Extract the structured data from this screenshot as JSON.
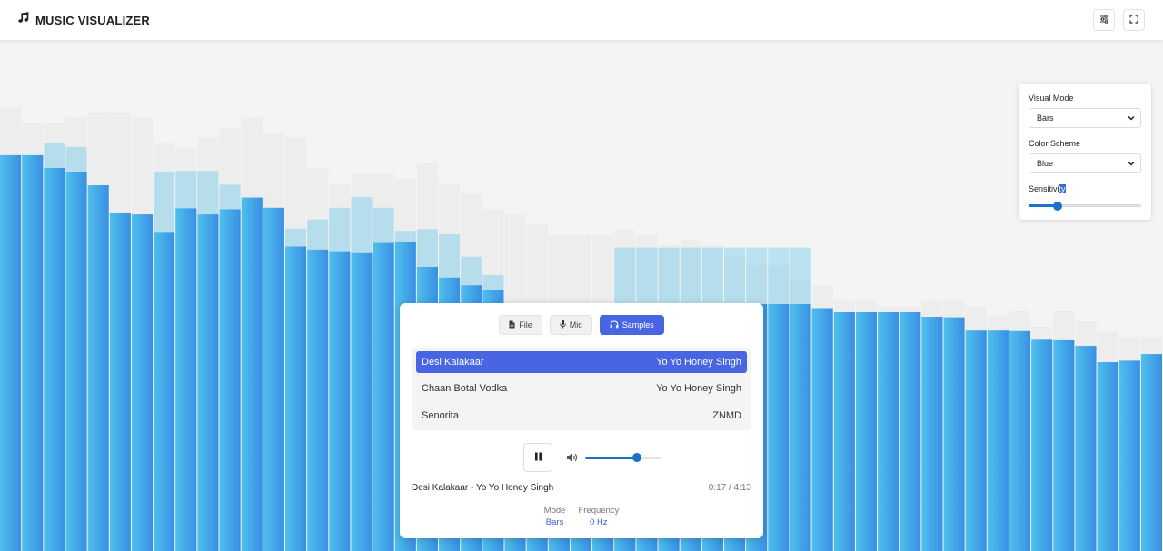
{
  "app": {
    "title": "MUSIC VISUALIZER"
  },
  "header": {
    "buttons": [
      {
        "name": "settings-toggle-button",
        "icon": "sliders-icon"
      },
      {
        "name": "fullscreen-button",
        "icon": "expand-icon"
      }
    ]
  },
  "settings": {
    "visual_mode_label": "Visual Mode",
    "visual_mode_value": "Bars",
    "color_scheme_label": "Color Scheme",
    "color_scheme_value": "Blue",
    "sensitivity_label_a": "Sensitivi",
    "sensitivity_label_b": "ty",
    "sensitivity_fraction": 0.26
  },
  "player": {
    "source_tabs": [
      {
        "label": "File",
        "icon": "file-icon",
        "active": false
      },
      {
        "label": "Mic",
        "icon": "microphone-icon",
        "active": false
      },
      {
        "label": "Samples",
        "icon": "headphones-icon",
        "active": true
      }
    ],
    "tracks": [
      {
        "title": "Desi Kalakaar",
        "artist": "Yo Yo Honey Singh",
        "active": true
      },
      {
        "title": "Chaan Botal Vodka",
        "artist": "Yo Yo Honey Singh",
        "active": false
      },
      {
        "title": "Senorita",
        "artist": "ZNMD",
        "active": false
      }
    ],
    "play_state": "pause-icon",
    "volume_fraction": 0.68,
    "now_playing": "Desi Kalakaar - Yo Yo Honey Singh",
    "time": "0:17 / 4:13",
    "stats": [
      {
        "label": "Mode",
        "value": "Bars"
      },
      {
        "label": "Frequency",
        "value": "0 Hz"
      }
    ]
  },
  "visualizer": {
    "mode": "Bars",
    "color_scheme": "Blue",
    "color_start": "#4ec0ec",
    "color_end": "#3a8fe4",
    "bar_levels": [
      0.776,
      0.776,
      0.751,
      0.742,
      0.717,
      0.662,
      0.66,
      0.624,
      0.672,
      0.66,
      0.67,
      0.693,
      0.673,
      0.597,
      0.591,
      0.586,
      0.584,
      0.604,
      0.605,
      0.557,
      0.536,
      0.521,
      0.511,
      0.484,
      0.484,
      0.484,
      0.484,
      0.484,
      0.484,
      0.484,
      0.484,
      0.484,
      0.484,
      0.484,
      0.484,
      0.484,
      0.484,
      0.476,
      0.468,
      0.468,
      0.468,
      0.468,
      0.459,
      0.458,
      0.432,
      0.432,
      0.431,
      0.414,
      0.413,
      0.402,
      0.37,
      0.373,
      0.386
    ],
    "peak_levels": [
      0.776,
      0.776,
      0.799,
      0.792,
      0.717,
      0.662,
      0.66,
      0.744,
      0.745,
      0.745,
      0.718,
      0.693,
      0.673,
      0.632,
      0.65,
      0.673,
      0.694,
      0.673,
      0.626,
      0.631,
      0.621,
      0.577,
      0.541,
      0.484,
      0.484,
      0.484,
      0.484,
      0.484,
      0.595,
      0.595,
      0.595,
      0.595,
      0.595,
      0.595,
      0.595,
      0.595,
      0.595,
      0.476,
      0.468,
      0.468,
      0.468,
      0.468,
      0.459,
      0.458,
      0.432,
      0.432,
      0.431,
      0.414,
      0.413,
      0.402,
      0.37,
      0.373,
      0.386
    ],
    "ghost_levels": [
      0.87,
      0.84,
      0.84,
      0.85,
      0.86,
      0.86,
      0.85,
      0.8,
      0.79,
      0.81,
      0.83,
      0.85,
      0.82,
      0.81,
      0.75,
      0.72,
      0.74,
      0.74,
      0.73,
      0.76,
      0.72,
      0.7,
      0.67,
      0.66,
      0.64,
      0.62,
      0.62,
      0.62,
      0.63,
      0.62,
      0.6,
      0.61,
      0.6,
      0.58,
      0.56,
      0.56,
      0.53,
      0.52,
      0.49,
      0.49,
      0.48,
      0.48,
      0.49,
      0.49,
      0.48,
      0.46,
      0.47,
      0.44,
      0.47,
      0.45,
      0.43,
      0.42,
      0.42
    ]
  }
}
